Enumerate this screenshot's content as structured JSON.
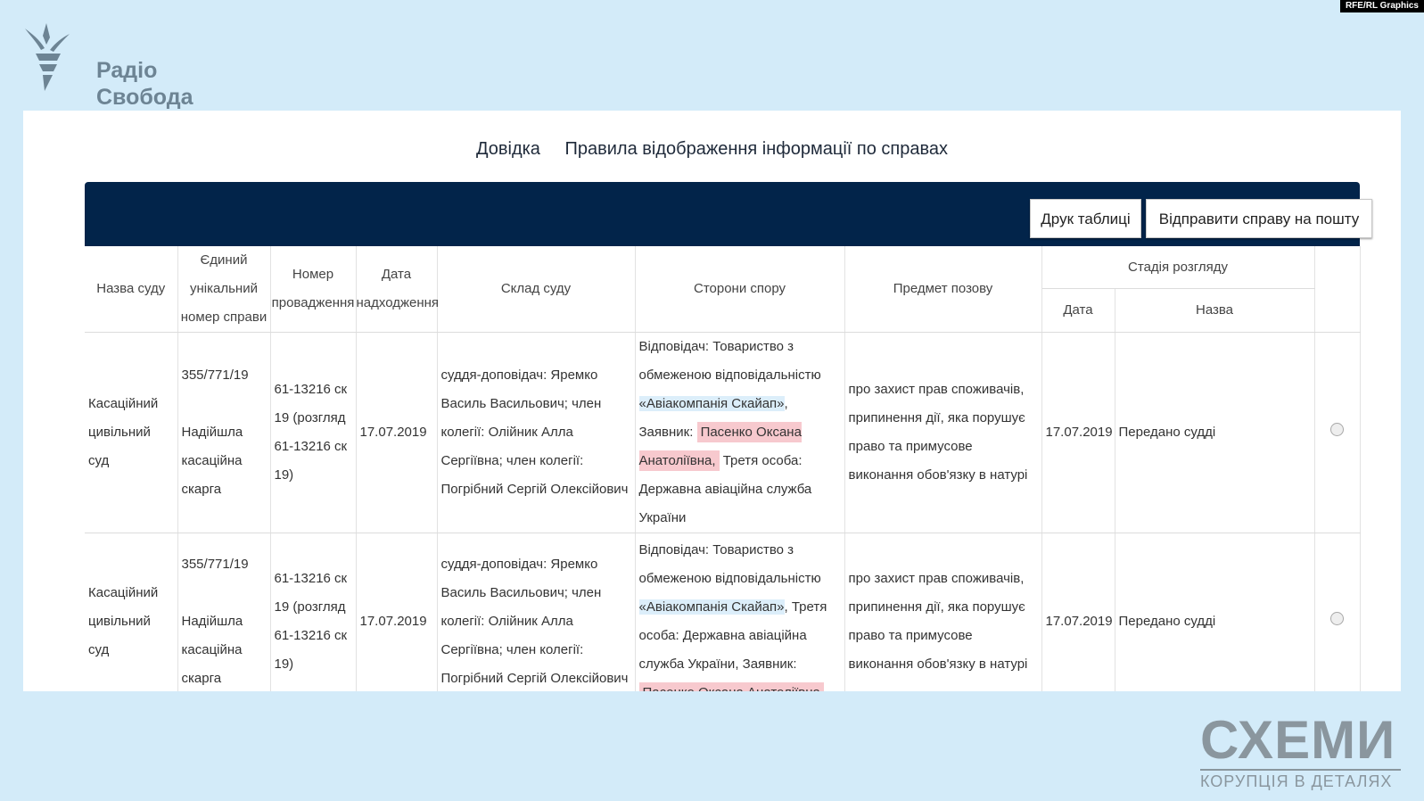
{
  "credit": "RFE/RL Graphics",
  "brand": {
    "line1": "Радіо",
    "line2": "Свобода"
  },
  "links": {
    "help": "Довідка",
    "rules": "Правила відображення інформації по справах"
  },
  "buttons": {
    "print": "Друк таблиці",
    "email": "Відправити справу на пошту"
  },
  "headers": {
    "court": "Назва суду",
    "case_number": "Єдиний унікальний номер справи",
    "proceeding": "Номер провадження",
    "received": "Дата надходження",
    "panel": "Склад суду",
    "parties": "Сторони спору",
    "subject": "Предмет позову",
    "stage": "Стадія розгляду",
    "stage_date": "Дата",
    "stage_name": "Назва"
  },
  "rows": [
    {
      "court": "Касаційний цивільний суд",
      "case_number": "355/771/19",
      "case_type": "Надійшла касаційна скарга",
      "proceeding": "61-13216 ск 19 (розгляд 61-13216 ск 19)",
      "received": "17.07.2019",
      "panel": "суддя-доповідач: Яремко Василь Васильович; член колегії: Олійник Алла Сергіївна; член колегії: Погрібний Сергій Олексійович",
      "parties_a": "Відповідач: Товариство з обмеженою відповідальністю",
      "parties_company": "«Авіакомпанія Скайап»",
      "parties_b": ", Заявник:",
      "parties_person": "Пасенко Оксана Анатоліївна,",
      "parties_c": "Третя особа: Державна авіаційна служба України",
      "subject": "про захист прав споживачів, припинення дії, яка порушує право та примусове виконання обов'язку в натурі",
      "stage_date": "17.07.2019",
      "stage_name": "Передано судді"
    },
    {
      "court": "Касаційний цивільний суд",
      "case_number": "355/771/19",
      "case_type": "Надійшла касаційна скарга",
      "proceeding": "61-13216 ск 19 (розгляд 61-13216 ск 19)",
      "received": "17.07.2019",
      "panel": "суддя-доповідач: Яремко Василь Васильович; член колегії: Олійник Алла Сергіївна; член колегії: Погрібний Сергій Олексійович",
      "parties_a": "Відповідач: Товариство з обмеженою відповідальністю",
      "parties_company": "«Авіакомпанія Скайап»",
      "parties_b": ", Третя особа: Державна авіаційна служба України, Заявник:",
      "parties_person": "Пасенко Оксана Анатоліївна",
      "parties_c": "",
      "subject": "про захист прав споживачів, припинення дії, яка порушує право та примусове виконання обов'язку в натурі",
      "stage_date": "17.07.2019",
      "stage_name": "Передано судді"
    }
  ],
  "footer": {
    "title": "СХЕМИ",
    "subtitle": "КОРУПЦІЯ В ДЕТАЛЯХ"
  },
  "colors": {
    "background": "#d3ebf9",
    "toolbar": "#02244a",
    "highlight_company": "#dceefa",
    "highlight_person": "#f7c9ce"
  }
}
